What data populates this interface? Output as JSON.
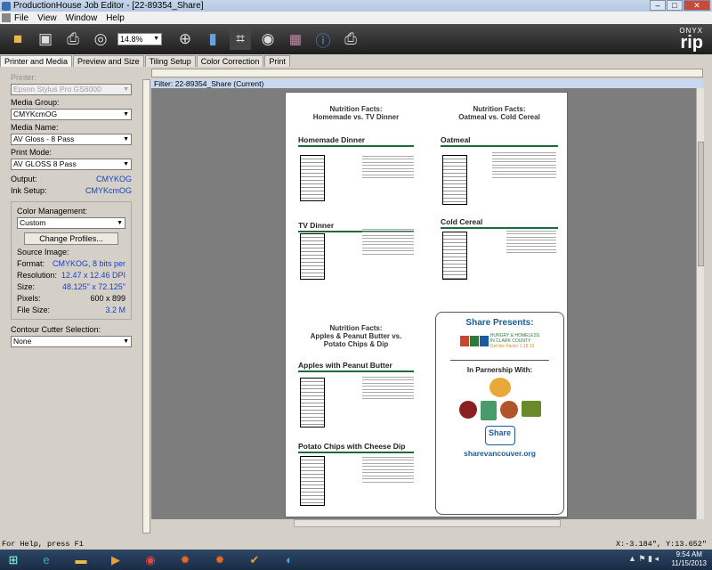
{
  "window": {
    "title": "ProductionHouse Job Editor - [22-89354_Share]",
    "min": "–",
    "max": "□",
    "close": "✕"
  },
  "menu": [
    "File",
    "View",
    "Window",
    "Help"
  ],
  "toolbar": {
    "zoom": "14.8%"
  },
  "brand": {
    "onyx": "ONYX",
    "rip": "rip"
  },
  "tabs": [
    "Printer and Media",
    "Preview and Size",
    "Tiling Setup",
    "Color Correction",
    "Print"
  ],
  "left": {
    "printer_label": "Printer:",
    "printer_value": "Epson Stylus Pro GS6000",
    "media_group_label": "Media Group:",
    "media_group_value": "CMYKcmOG",
    "media_name_label": "Media Name:",
    "media_name_value": "AV Gloss - 8 Pass",
    "print_mode_label": "Print Mode:",
    "print_mode_value": "AV GLOSS 8 Pass",
    "output_label": "Output:",
    "output_value": "CMYKOG",
    "ink_setup_label": "Ink Setup:",
    "ink_setup_value": "CMYKcmOG",
    "color_mgmt_label": "Color Management:",
    "color_mgmt_value": "Custom",
    "change_profiles": "Change Profiles...",
    "source_image_label": "Source Image:",
    "format_label": "Format:",
    "format_value": "CMYKOG, 8 bits per",
    "resolution_label": "Resolution:",
    "resolution_value": "12.47 x 12.46 DPI",
    "size_label": "Size:",
    "size_value": "48.125\" x 72.125\"",
    "pixels_label": "Pixels:",
    "pixels_value": "600 x 899",
    "filesize_label": "File Size:",
    "filesize_value": "3.2 M",
    "contour_label": "Contour Cutter Selection:",
    "contour_value": "None"
  },
  "filter_bar": "Filter: 22-89354_Share (Current)",
  "paper": {
    "p1_title1": "Nutrition Facts:",
    "p1_title2": "Homemade vs. TV Dinner",
    "p1_sec1": "Homemade Dinner",
    "p1_sec2": "TV Dinner",
    "p2_title1": "Nutrition Facts:",
    "p2_title2": "Oatmeal vs. Cold Cereal",
    "p2_sec1": "Oatmeal",
    "p2_sec2": "Cold Cereal",
    "p3_title1": "Nutrition Facts:",
    "p3_title2": "Apples & Peanut Butter vs.",
    "p3_title3": "Potato Chips & Dip",
    "p3_sec1": "Apples with Peanut Butter",
    "p3_sec2": "Potato Chips with Cheese Dip",
    "share_presents": "Share Presents:",
    "hh_line1": "HUNGRY & HOMELESS",
    "hh_line2": "IN CLARK COUNTY",
    "hh_tag": "Get the Facts!  1.19.13",
    "partnership": "In Parnership With:",
    "share_logo": "Share",
    "share_url": "sharevancouver.org"
  },
  "status": {
    "help": "For Help, press F1",
    "coords": "X:-3.184\", Y:13.652\""
  },
  "taskbar": {
    "time": "9:54 AM",
    "date": "11/15/2013"
  }
}
